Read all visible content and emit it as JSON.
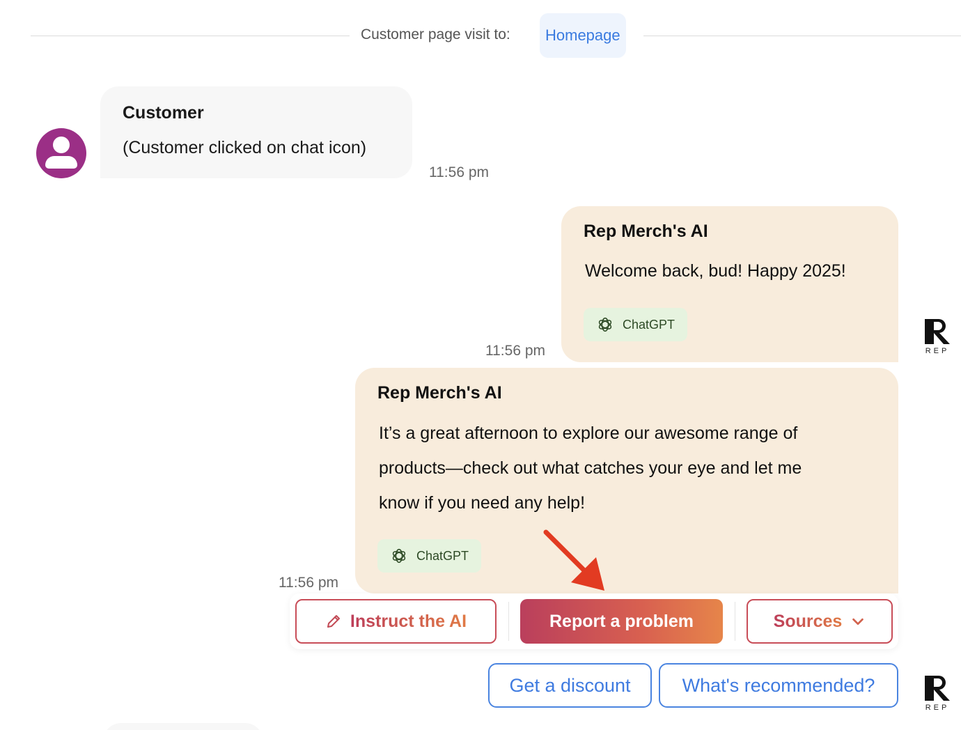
{
  "visit": {
    "label": "Customer page visit to:",
    "page": "Homepage"
  },
  "messages": [
    {
      "sender": "Customer",
      "text": "(Customer clicked on chat icon)",
      "time": "11:56 pm"
    },
    {
      "sender": "Rep Merch's AI",
      "text": "Welcome back, bud! Happy 2025!",
      "chip": "ChatGPT",
      "time": "11:56 pm"
    },
    {
      "sender": "Rep Merch's AI",
      "lines": [
        "It’s a great afternoon to explore our awesome range of",
        "products—check out what catches your eye and let me",
        "know if you need any help!"
      ],
      "chip": "ChatGPT",
      "time": "11:56 pm"
    }
  ],
  "actions": {
    "instruct": "Instruct the AI",
    "report": "Report a problem",
    "sources": "Sources"
  },
  "suggestions": [
    "Get a discount",
    "What's recommended?"
  ],
  "brand": {
    "logo_text": "REP"
  },
  "icons": {
    "avatar": "user-avatar-icon",
    "chip": "chatgpt-logo-icon",
    "instruct": "pencil-icon",
    "sources": "chevron-down-icon",
    "annotation": "red-arrow"
  },
  "colors": {
    "customer_avatar": "#9b2f86",
    "ai_bubble": "#f8ecdc",
    "chip_bg": "#e6f3df",
    "accent_start": "#ba3f5c",
    "accent_end": "#e6854a",
    "link_blue": "#3f7be0",
    "annotation_arrow": "#e23b22"
  }
}
